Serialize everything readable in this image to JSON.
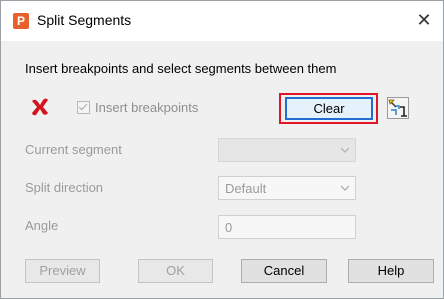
{
  "window": {
    "title": "Split Segments",
    "app_icon_letter": "P"
  },
  "instruction": "Insert breakpoints and select segments between them",
  "toolbar": {
    "insert_breakpoints_label": "Insert breakpoints",
    "insert_breakpoints_checked": true,
    "clear_label": "Clear",
    "highlight_color": "#e0152a",
    "icons": [
      "red-x-icon",
      "segment-pick-icon"
    ]
  },
  "fields": {
    "current_segment_label": "Current segment",
    "current_segment_value": "",
    "split_direction_label": "Split direction",
    "split_direction_value": "Default",
    "angle_label": "Angle",
    "angle_value": "0"
  },
  "buttons": {
    "preview": "Preview",
    "ok": "OK",
    "cancel": "Cancel",
    "help": "Help"
  }
}
